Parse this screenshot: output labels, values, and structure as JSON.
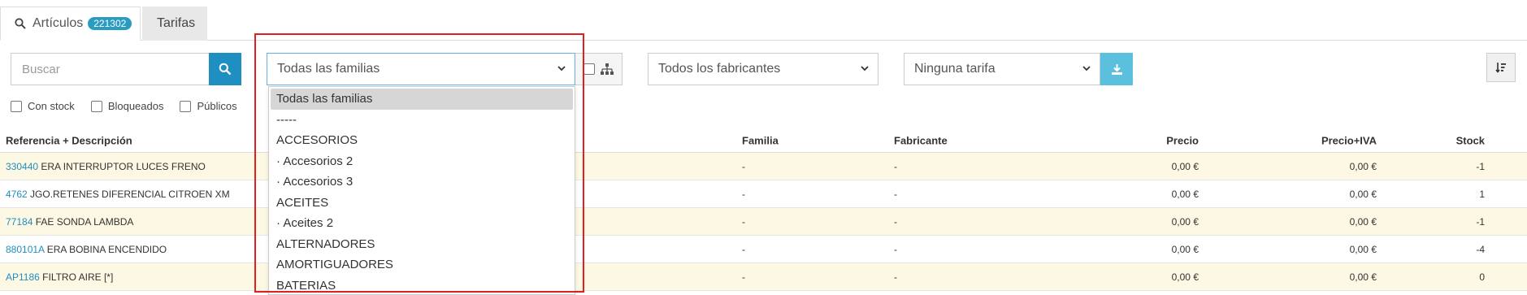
{
  "tabs": {
    "articulos_label": "Artículos",
    "articulos_count": "221302",
    "tarifas_label": "Tarifas"
  },
  "toolbar": {
    "search_placeholder": "Buscar",
    "families_selected": "Todas las familias",
    "manufacturers_selected": "Todos los fabricantes",
    "tariff_selected": "Ninguna tarifa"
  },
  "filters": {
    "stock_label": "Con stock",
    "blocked_label": "Bloqueados",
    "public_label": "Públicos"
  },
  "table": {
    "headers": {
      "ref_desc": "Referencia + Descripción",
      "family": "Familia",
      "manufacturer": "Fabricante",
      "price": "Precio",
      "price_vat": "Precio+IVA",
      "stock": "Stock"
    },
    "rows": [
      {
        "ref": "330440",
        "desc": "ERA INTERRUPTOR LUCES FRENO",
        "family": "-",
        "manufacturer": "-",
        "price": "0,00 €",
        "price_vat": "0,00 €",
        "stock": "-1"
      },
      {
        "ref": "4762",
        "desc": "JGO.RETENES DIFERENCIAL CITROEN XM",
        "family": "-",
        "manufacturer": "-",
        "price": "0,00 €",
        "price_vat": "0,00 €",
        "stock": "1"
      },
      {
        "ref": "77184",
        "desc": "FAE SONDA LAMBDA",
        "family": "-",
        "manufacturer": "-",
        "price": "0,00 €",
        "price_vat": "0,00 €",
        "stock": "-1"
      },
      {
        "ref": "880101A",
        "desc": "ERA BOBINA ENCENDIDO",
        "family": "-",
        "manufacturer": "-",
        "price": "0,00 €",
        "price_vat": "0,00 €",
        "stock": "-4"
      },
      {
        "ref": "AP1186",
        "desc": "FILTRO AIRE [*]",
        "family": "-",
        "manufacturer": "-",
        "price": "0,00 €",
        "price_vat": "0,00 €",
        "stock": "0"
      }
    ]
  },
  "families_dropdown": {
    "options": [
      "Todas las familias",
      "-----",
      "ACCESORIOS",
      "· Accesorios 2",
      "· Accesorios 3",
      "ACEITES",
      "· Aceites 2",
      "ALTERNADORES",
      "AMORTIGUADORES",
      "BATERIAS"
    ]
  },
  "colors": {
    "accent": "#1f8ec0",
    "download": "#5bc0de",
    "row_highlight": "#fcf8e3",
    "annotation": "#e02020"
  },
  "icons": [
    "search-icon",
    "sitemap-icon",
    "download-icon",
    "sort-icon",
    "chevron-down-icon"
  ]
}
